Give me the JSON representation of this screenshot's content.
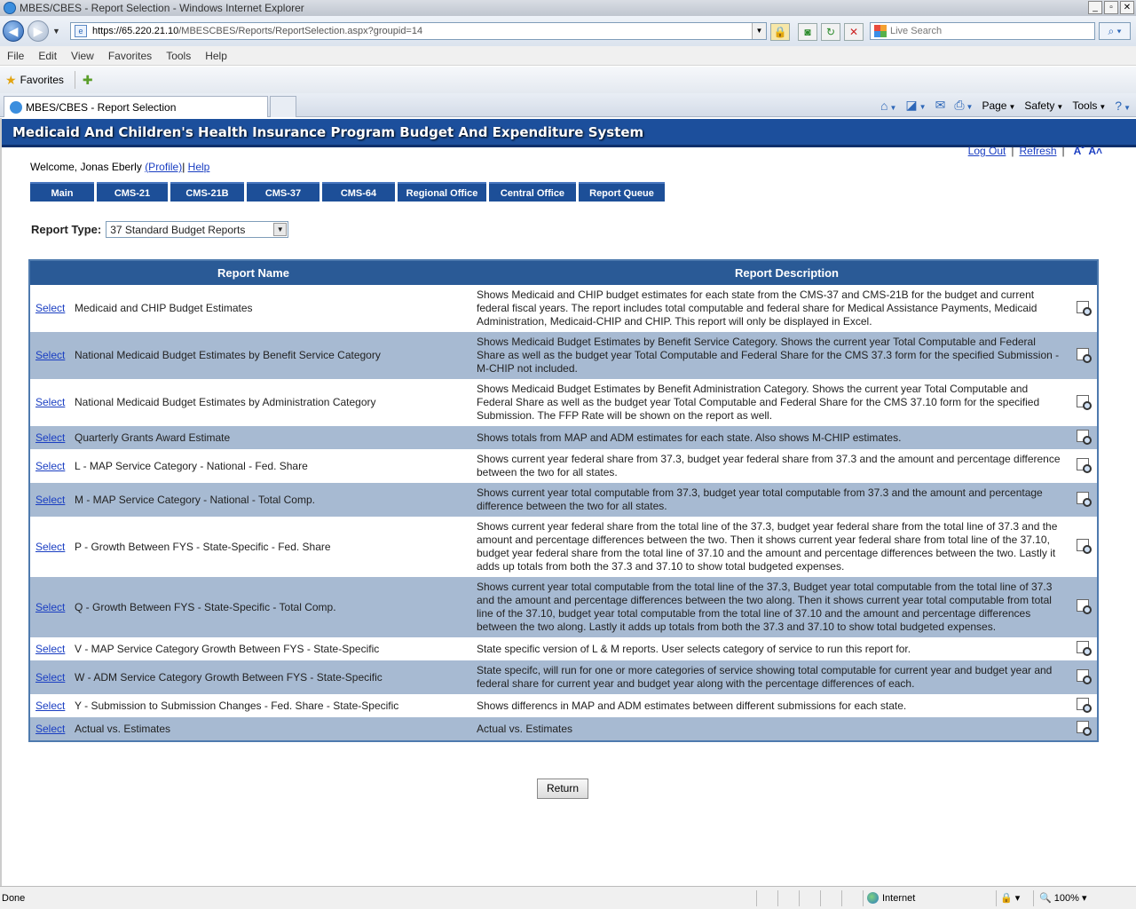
{
  "window": {
    "title": "MBES/CBES - Report Selection - Windows Internet Explorer",
    "min": "_",
    "max": "▫",
    "close": "✕"
  },
  "browser": {
    "url_host": "https://65.220.21.10",
    "url_path": "/MBESCBES/Reports/ReportSelection.aspx?groupid=14",
    "search_placeholder": "Live Search",
    "menu": [
      "File",
      "Edit",
      "View",
      "Favorites",
      "Tools",
      "Help"
    ],
    "favorites_label": "Favorites",
    "tab_title": "MBES/CBES - Report Selection",
    "commands": {
      "page": "Page",
      "safety": "Safety",
      "tools": "Tools"
    },
    "status": "Done",
    "zone": "Internet",
    "zoom": "100%"
  },
  "app": {
    "title": "Medicaid And Children's Health Insurance Program Budget And Expenditure System",
    "logout": "Log Out",
    "refresh": "Refresh",
    "welcome_prefix": "Welcome, Jonas Eberly",
    "profile": "(Profile)",
    "profile_sep": "|",
    "help": "Help",
    "tabs": [
      "Main",
      "CMS-21",
      "CMS-21B",
      "CMS-37",
      "CMS-64",
      "Regional Office",
      "Central Office",
      "Report Queue"
    ],
    "report_type_label": "Report Type:",
    "report_type_value": "37 Standard Budget Reports",
    "col_name": "Report Name",
    "col_desc": "Report Description",
    "select_label": "Select",
    "return_label": "Return"
  },
  "reports": [
    {
      "name": "Medicaid and CHIP Budget Estimates",
      "desc": "Shows Medicaid and CHIP budget estimates for each state from the CMS-37 and CMS-21B for the budget and current federal fiscal years. The report includes total computable and federal share for Medical Assistance Payments, Medicaid Administration, Medicaid-CHIP and CHIP. This report will only be displayed in Excel."
    },
    {
      "name": "National Medicaid Budget Estimates by Benefit Service Category",
      "desc": "Shows Medicaid Budget Estimates by Benefit Service Category. Shows the current year Total Computable and Federal Share as well as the budget year Total Computable and Federal Share for the CMS 37.3 form for the specified Submission - M-CHIP not included."
    },
    {
      "name": "National Medicaid Budget Estimates by Administration Category",
      "desc": "Shows Medicaid Budget Estimates by Benefit Administration Category. Shows the current year Total Computable and Federal Share as well as the budget year Total Computable and Federal Share for the CMS 37.10 form for the specified Submission. The FFP Rate will be shown on the report as well."
    },
    {
      "name": "Quarterly Grants Award Estimate",
      "desc": "Shows totals from MAP and ADM estimates for each state. Also shows M-CHIP estimates."
    },
    {
      "name": "L - MAP Service Category - National - Fed. Share",
      "desc": "Shows current year federal share from 37.3, budget year federal share from 37.3 and the amount and percentage difference between the two for all states."
    },
    {
      "name": "M - MAP Service Category - National - Total Comp.",
      "desc": "Shows current year total computable from 37.3, budget year total computable from 37.3 and the amount and percentage difference between the two for all states."
    },
    {
      "name": "P - Growth Between FYS - State-Specific - Fed. Share",
      "desc": "Shows current year federal share from the total line of the 37.3, budget year federal share from the total line of 37.3 and the amount and percentage differences between the two. Then it shows current year federal share from total line of the 37.10, budget year federal share from the total line of 37.10 and the amount and percentage differences between the two. Lastly it adds up totals from both the 37.3 and 37.10 to show total budgeted expenses."
    },
    {
      "name": "Q - Growth Between FYS - State-Specific - Total Comp.",
      "desc": "Shows current year total computable from the total line of the 37.3, Budget year total computable from the total line of 37.3 and the amount and percentage differences between the two along. Then it shows current year total computable from total line of the 37.10, budget year total computable from the total line of 37.10 and the amount and percentage differences between the two along. Lastly it adds up totals from both the 37.3 and 37.10 to show total budgeted expenses."
    },
    {
      "name": "V - MAP Service Category Growth Between FYS - State-Specific",
      "desc": "State specific version of L & M reports. User selects category of service to run this report for."
    },
    {
      "name": "W - ADM Service Category Growth Between FYS - State-Specific",
      "desc": "State specifc, will run for one or more categories of service showing total computable for current year and budget year and federal share for current year and budget year along with the percentage differences of each."
    },
    {
      "name": "Y - Submission to Submission Changes - Fed. Share - State-Specific",
      "desc": "Shows differencs in MAP and ADM estimates between different submissions for each state."
    },
    {
      "name": "Actual vs. Estimates",
      "desc": "Actual vs. Estimates"
    }
  ],
  "colors": {
    "header_blue": "#1c4f9c",
    "row_alt": "#a7bad2",
    "link": "#1a3ec2"
  }
}
